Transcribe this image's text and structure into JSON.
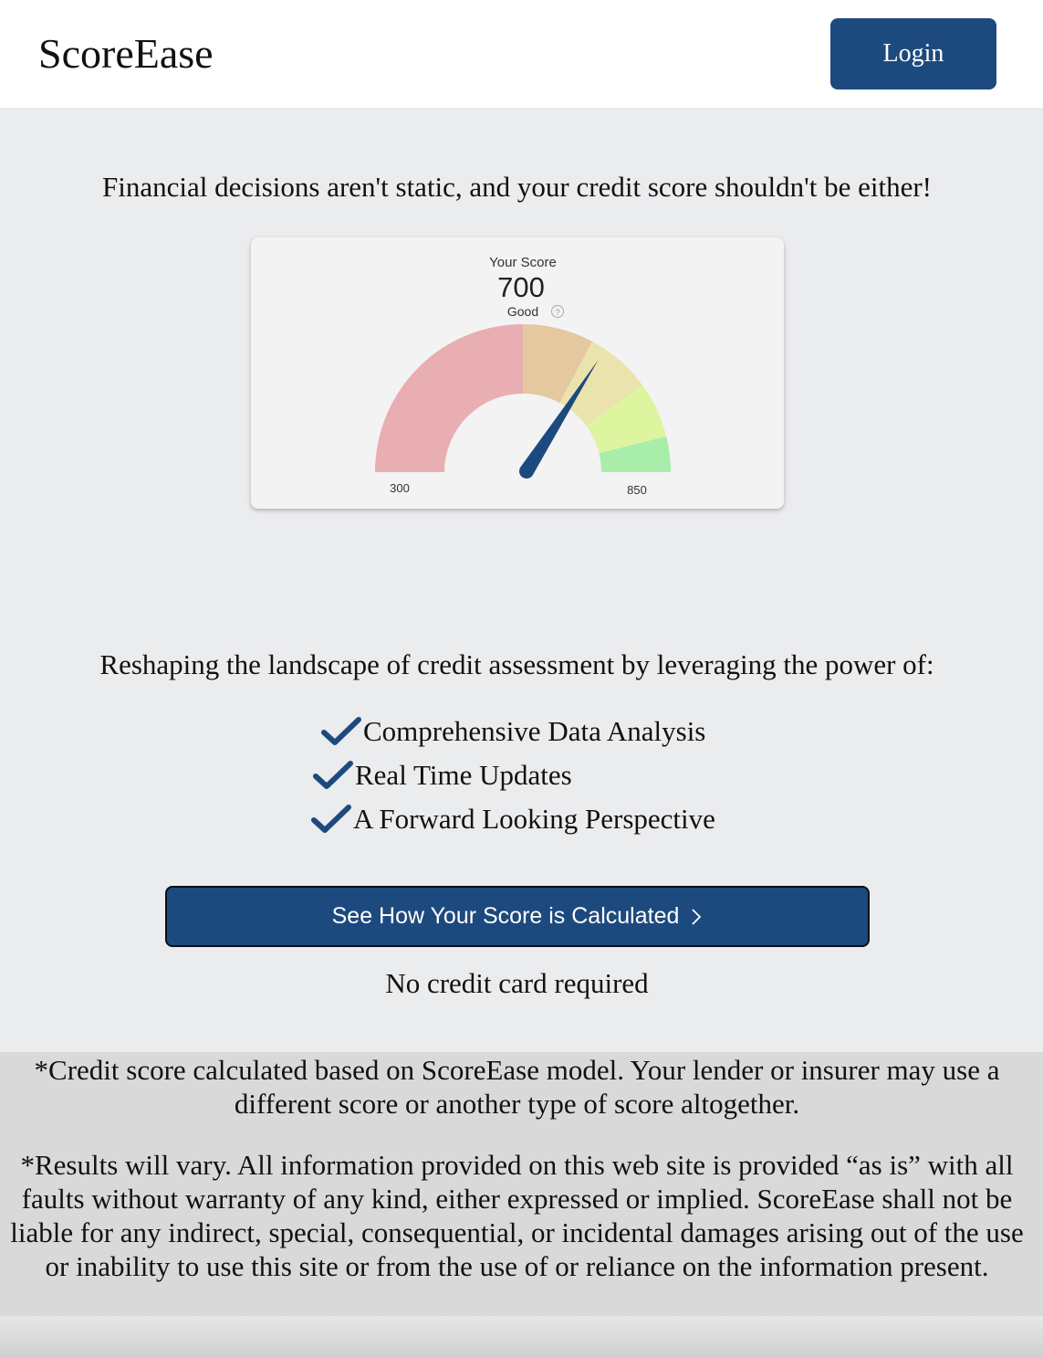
{
  "header": {
    "brand": "ScoreEase",
    "login_label": "Login",
    "brand_color": "#1d4a7e"
  },
  "tagline": "Financial decisions aren't static, and your credit score shouldn't be either!",
  "score_card": {
    "label": "Your Score",
    "score": 700,
    "score_text": "700",
    "rating": "Good",
    "info_icon": "question-circle-icon",
    "min_label": "300",
    "max_label": "850",
    "segment_colors": [
      "#e8aeb2",
      "#e5c8a0",
      "#ebe3ad",
      "#def5a0",
      "#a8eeaa"
    ],
    "needle_color": "#1d4a7e"
  },
  "lead": "Reshaping the landscape of credit assessment by leveraging the power of:",
  "features": [
    {
      "label": "Comprehensive Data Analysis",
      "icon": "check-icon"
    },
    {
      "label": "Real Time Updates",
      "icon": "check-icon"
    },
    {
      "label": "A Forward Looking Perspective",
      "icon": "check-icon"
    }
  ],
  "cta": {
    "label": "See How Your Score is Calculated",
    "icon": "chevron-right-icon",
    "note": "No credit card required"
  },
  "disclaimers": [
    "*Credit score calculated based on ScoreEase model. Your lender or insurer may use a different score or another type of score altogether.",
    "*Results will vary. All information provided on this web site is provided “as is” with all faults without warranty of any kind, either expressed or implied. ScoreEase shall not be liable for any indirect, special, consequential, or incidental damages arising out of the use or inability to use this site or from the use of or reliance on the information present."
  ]
}
